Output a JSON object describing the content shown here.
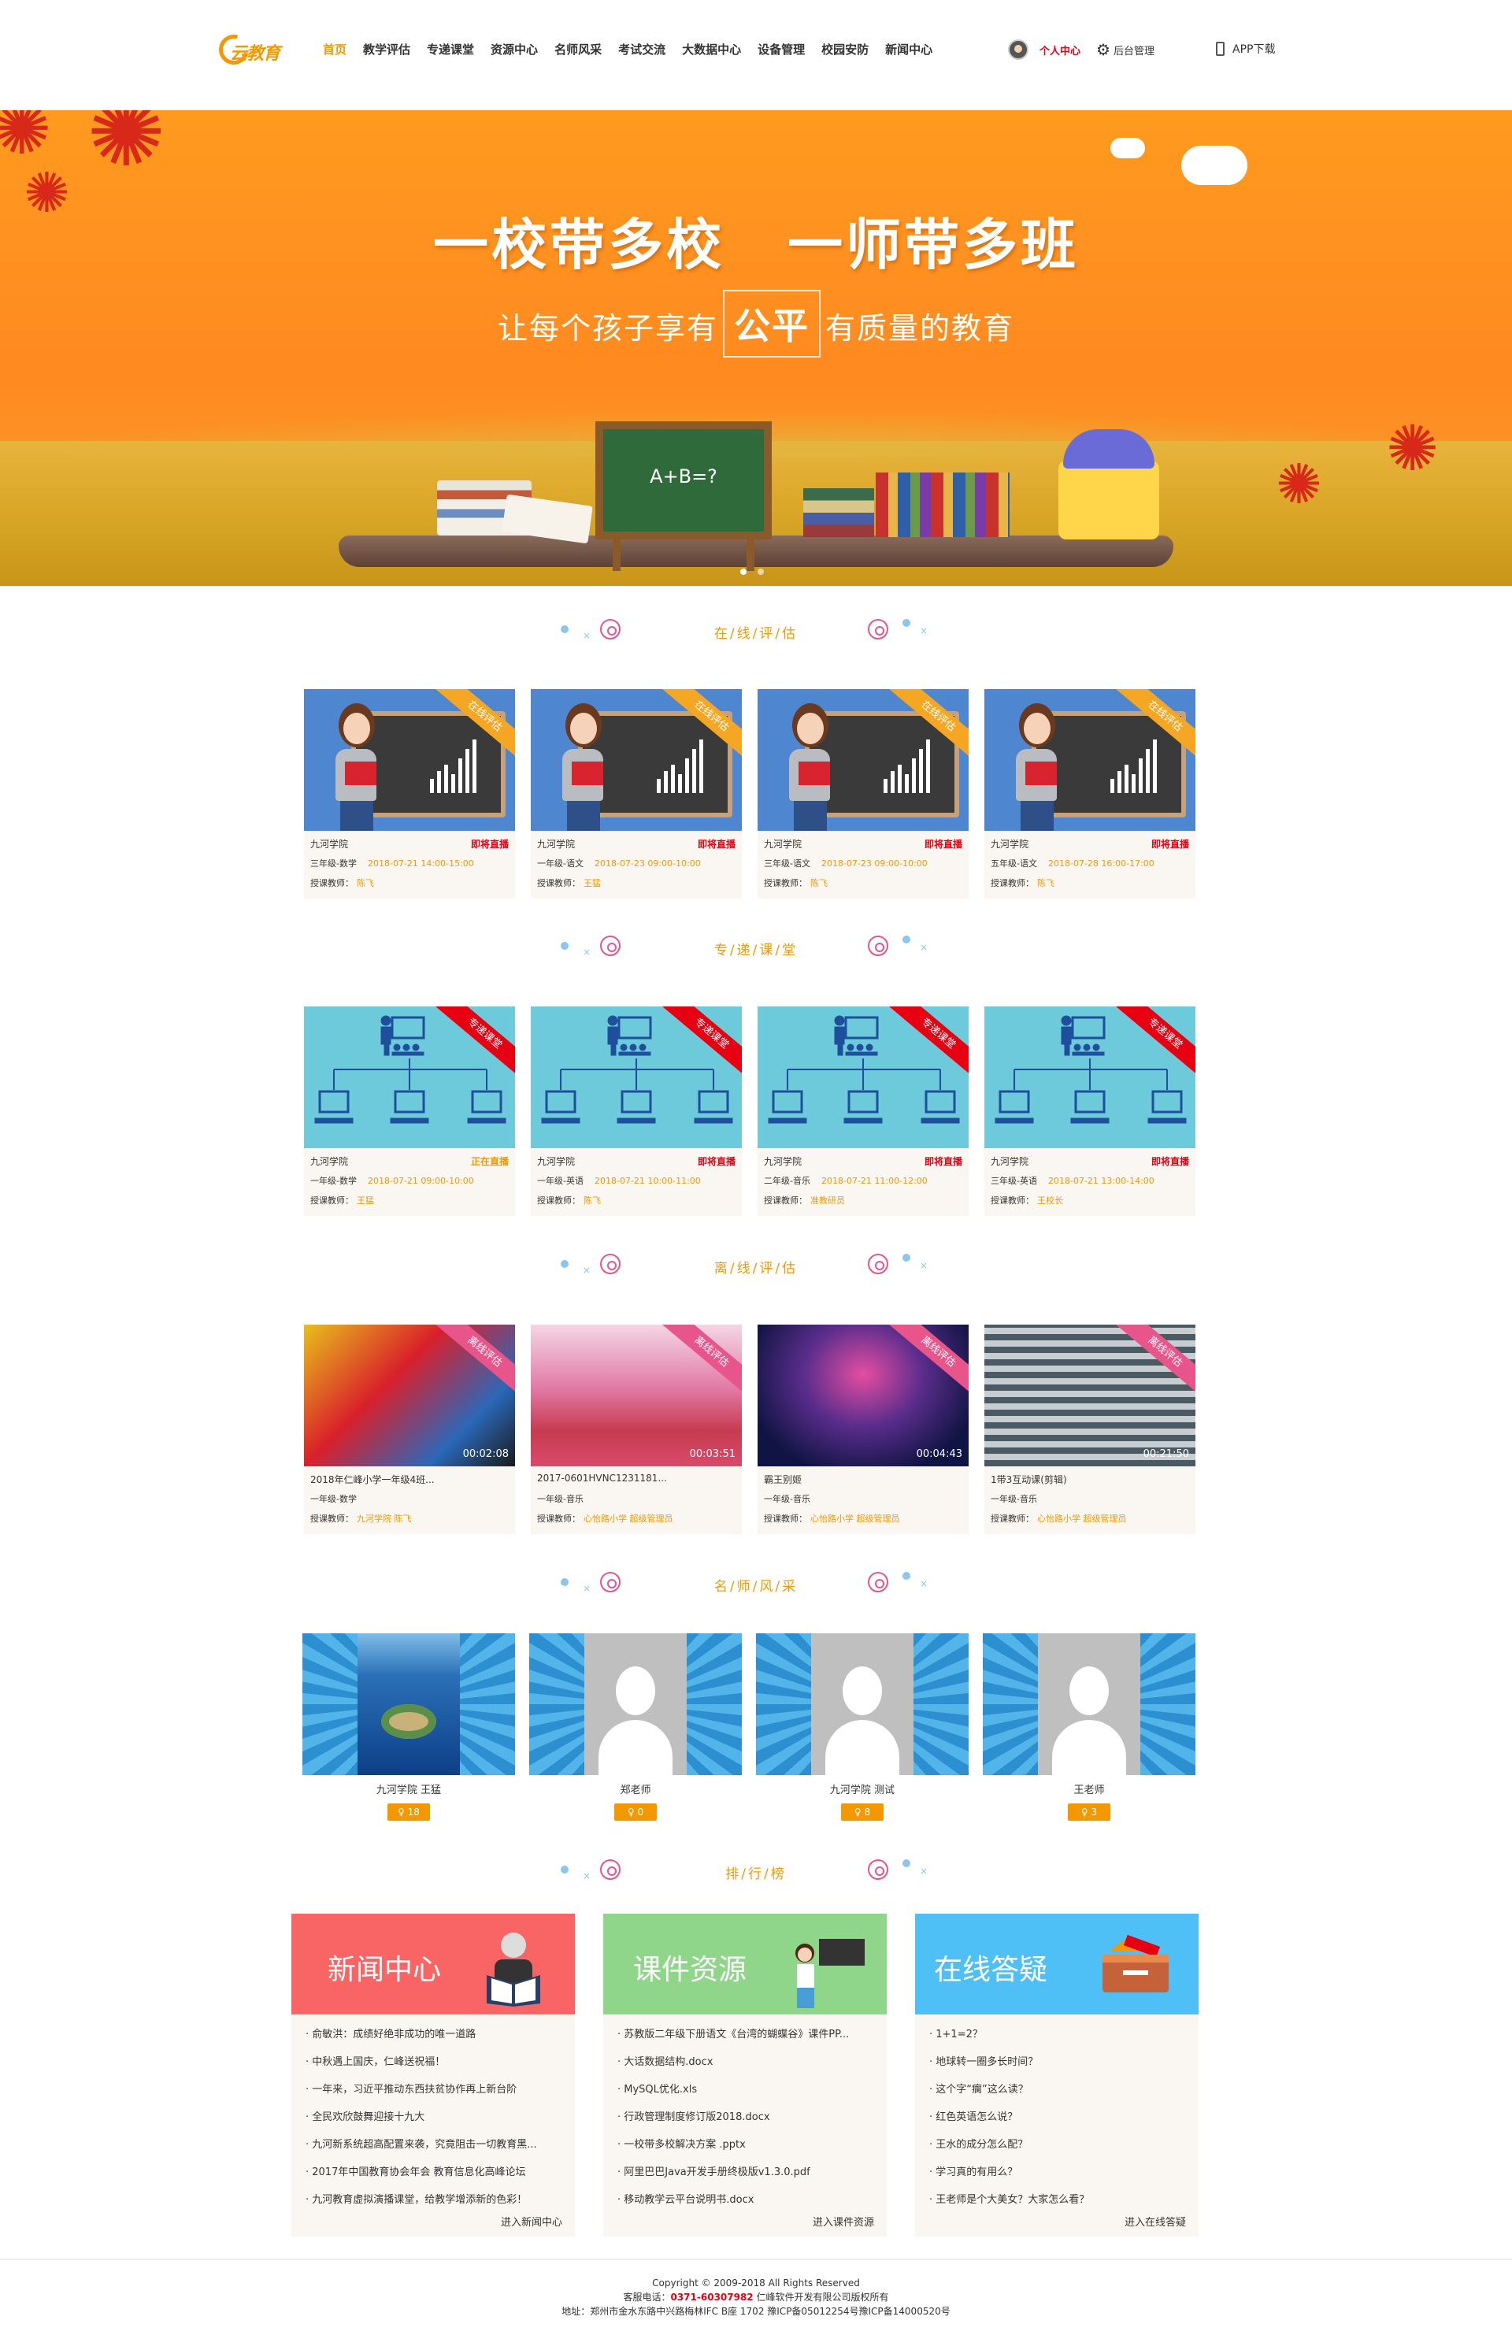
{
  "brand": {
    "logo_text": "云教育"
  },
  "nav": [
    "首页",
    "教学评估",
    "专递课堂",
    "资源中心",
    "名师风采",
    "考试交流",
    "大数据中心",
    "设备管理",
    "校园安防",
    "新闻中心"
  ],
  "header": {
    "personal_center": "个人中心",
    "admin": "后台管理",
    "app_download": "APP下载"
  },
  "banner": {
    "title_a": "一校带多校",
    "title_b": "一师带多班",
    "subtitle_before": "让每个孩子享有",
    "subtitle_highlight": "公平",
    "subtitle_after": "有质量的教育",
    "board_text": "A+B=?"
  },
  "sections": {
    "online_eval": "在/线/评/估",
    "special": "专/递/课/堂",
    "offline_eval": "离/线/评/估",
    "teachers": "名/师/风/采",
    "ranking": "排/行/榜"
  },
  "online_eval": [
    {
      "ribbon": "在线评估",
      "school": "九河学院",
      "status": "即将直播",
      "course": "三年级-数学",
      "time": "2018-07-21   14:00-15:00",
      "teacher_label": "授课教师：",
      "teacher": "陈飞"
    },
    {
      "ribbon": "在线评估",
      "school": "九河学院",
      "status": "即将直播",
      "course": "一年级-语文",
      "time": "2018-07-23   09:00-10:00",
      "teacher_label": "授课教师：",
      "teacher": "王猛"
    },
    {
      "ribbon": "在线评估",
      "school": "九河学院",
      "status": "即将直播",
      "course": "三年级-语文",
      "time": "2018-07-23   09:00-10:00",
      "teacher_label": "授课教师：",
      "teacher": "陈飞"
    },
    {
      "ribbon": "在线评估",
      "school": "九河学院",
      "status": "即将直播",
      "course": "五年级-语文",
      "time": "2018-07-28   16:00-17:00",
      "teacher_label": "授课教师：",
      "teacher": "陈飞"
    }
  ],
  "special": [
    {
      "ribbon": "专递课堂",
      "school": "九河学院",
      "status": "正在直播",
      "course": "一年级-数学",
      "time": "2018-07-21   09:00-10:00",
      "teacher_label": "授课教师：",
      "teacher": "王猛"
    },
    {
      "ribbon": "专递课堂",
      "school": "九河学院",
      "status": "即将直播",
      "course": "一年级-英语",
      "time": "2018-07-21   10:00-11:00",
      "teacher_label": "授课教师：",
      "teacher": "陈飞"
    },
    {
      "ribbon": "专递课堂",
      "school": "九河学院",
      "status": "即将直播",
      "course": "二年级-音乐",
      "time": "2018-07-21   11:00-12:00",
      "teacher_label": "授课教师：",
      "teacher": "准教研员"
    },
    {
      "ribbon": "专递课堂",
      "school": "九河学院",
      "status": "即将直播",
      "course": "三年级-英语",
      "time": "2018-07-21   13:00-14:00",
      "teacher_label": "授课教师：",
      "teacher": "王校长"
    }
  ],
  "offline_eval": [
    {
      "ribbon": "离线评估",
      "title": "2018年仁峰小学一年级4班...",
      "course": "一年级-数学",
      "teacher_label": "授课教师：",
      "teacher": "九河学院   陈飞",
      "duration": "00:02:08"
    },
    {
      "ribbon": "离线评估",
      "title": "2017-0601HVNC1231181...",
      "course": "一年级-音乐",
      "teacher_label": "授课教师：",
      "teacher": "心怡路小学   超级管理员",
      "duration": "00:03:51"
    },
    {
      "ribbon": "离线评估",
      "title": "霸王别姬",
      "course": "一年级-音乐",
      "teacher_label": "授课教师：",
      "teacher": "心怡路小学   超级管理员",
      "duration": "00:04:43"
    },
    {
      "ribbon": "离线评估",
      "title": "1带3互动课(剪辑)",
      "course": "一年级-音乐",
      "teacher_label": "授课教师：",
      "teacher": "心怡路小学   超级管理员",
      "duration": "00:21:50"
    }
  ],
  "teachers": [
    {
      "name": "九河学院   王猛",
      "score": "♀ 18"
    },
    {
      "name": "郑老师",
      "score": "♀ 0"
    },
    {
      "name": "九河学院   测试",
      "score": "♀ 8"
    },
    {
      "name": "王老师",
      "score": "♀ 3"
    }
  ],
  "ranking": {
    "news": {
      "title": "新闻中心",
      "items": [
        "俞敏洪：成绩好绝非成功的唯一道路",
        "中秋遇上国庆，仁峰送祝福！",
        "一年来，习近平推动东西扶贫协作再上新台阶",
        "全民欢欣鼓舞迎接十九大",
        "九河新系统超高配置来袭，究竟阻击一切教育黑...",
        "2017年中国教育协会年会 教育信息化高峰论坛",
        "九河教育虚拟演播课堂，给教学增添新的色彩！"
      ],
      "more": "进入新闻中心",
      "color": "#f96565"
    },
    "courseware": {
      "title": "课件资源",
      "items": [
        "苏教版二年级下册语文《台湾的蝴蝶谷》课件PP...",
        "大话数据结构.docx",
        "MySQL优化.xls",
        "行政管理制度修订版2018.docx",
        "一校带多校解决方案 .pptx",
        "阿里巴巴Java开发手册终极版v1.3.0.pdf",
        "移动教学云平台说明书.docx"
      ],
      "more": "进入课件资源",
      "color": "#8fd68b"
    },
    "qa": {
      "title": "在线答疑",
      "items": [
        "1+1=2？",
        "地球转一圈多长时间？",
        "这个字“瘸”这么读？",
        "红色英语怎么说？",
        "王水的成分怎么配？",
        "学习真的有用么？",
        "王老师是个大美女？大家怎么看？"
      ],
      "more": "进入在线答疑",
      "color": "#4fc0f5"
    }
  },
  "footer": {
    "copyright": "Copyright © 2009-2018 All Rights Reserved",
    "phone_label": "客服电话：",
    "phone": "0371-60307982",
    "company": "仁峰软件开发有限公司版权所有",
    "address": "地址：郑州市金水东路中兴路梅林IFC B座 1702  豫ICP备05012254号豫ICP备14000520号"
  }
}
